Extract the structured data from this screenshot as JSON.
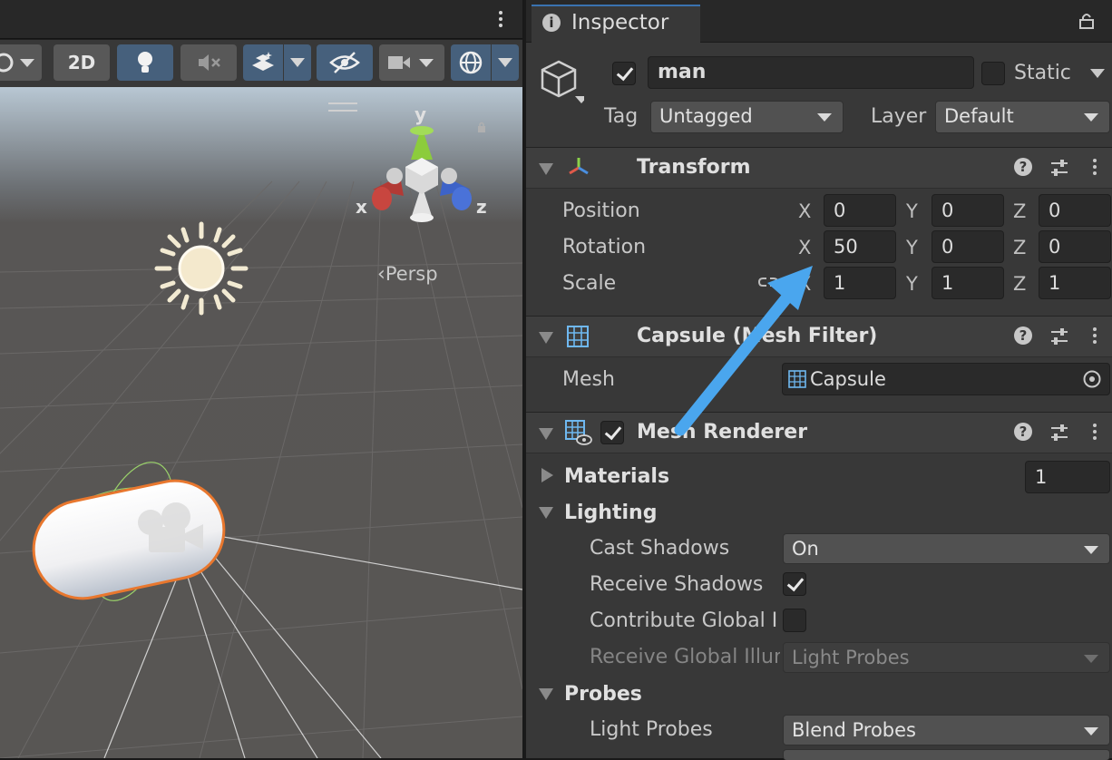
{
  "scene": {
    "toolbar": {
      "btn_2d": "2D"
    },
    "view": {
      "persp_label": "Persp",
      "gizmo": {
        "x": "x",
        "y": "y",
        "z": "z"
      }
    }
  },
  "inspector": {
    "tab_label": "Inspector",
    "object": {
      "name": "man",
      "active": true,
      "static_label": "Static",
      "static": false,
      "tag_label": "Tag",
      "tag_value": "Untagged",
      "layer_label": "Layer",
      "layer_value": "Default"
    },
    "transform": {
      "title": "Transform",
      "rows": [
        {
          "label": "Position",
          "x": "0",
          "y": "0",
          "z": "0"
        },
        {
          "label": "Rotation",
          "x": "50",
          "y": "0",
          "z": "0"
        },
        {
          "label": "Scale",
          "x": "1",
          "y": "1",
          "z": "1"
        }
      ],
      "axis": {
        "x": "X",
        "y": "Y",
        "z": "Z"
      }
    },
    "mesh_filter": {
      "title": "Capsule (Mesh Filter)",
      "mesh_label": "Mesh",
      "mesh_value": "Capsule"
    },
    "mesh_renderer": {
      "title": "Mesh Renderer",
      "enabled": true,
      "materials_label": "Materials",
      "materials_count": "1",
      "lighting_label": "Lighting",
      "cast_shadows_label": "Cast Shadows",
      "cast_shadows_value": "On",
      "receive_shadows_label": "Receive Shadows",
      "receive_shadows": true,
      "contribute_gi_label": "Contribute Global Illumination",
      "contribute_gi": false,
      "receive_gi_label": "Receive Global Illumination",
      "receive_gi_value": "Light Probes",
      "probes_label": "Probes",
      "light_probes_label": "Light Probes",
      "light_probes_value": "Blend Probes"
    }
  },
  "colors": {
    "accent_blue": "#4aa6ee",
    "selection_orange": "#e8772e",
    "panel": "#383838"
  }
}
